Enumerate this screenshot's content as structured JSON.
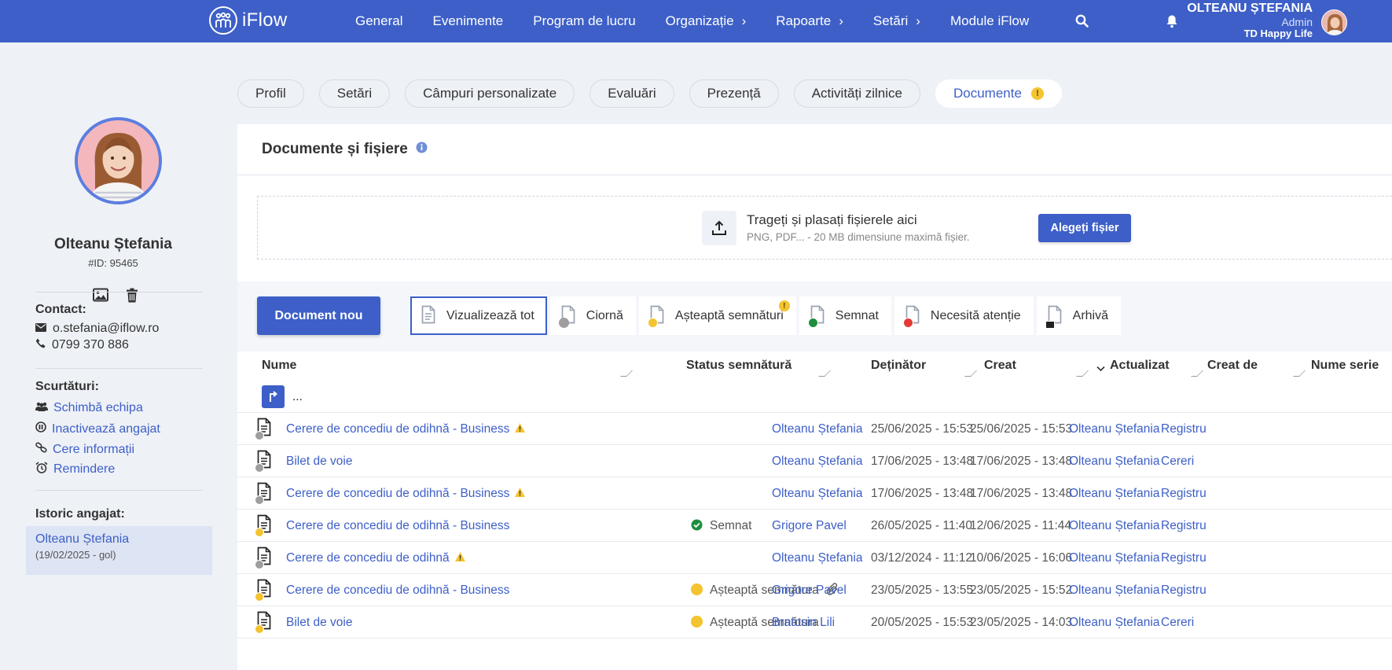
{
  "app": {
    "logo_text": "iFlow"
  },
  "nav": {
    "items": [
      {
        "label": "General",
        "chevron": false
      },
      {
        "label": "Evenimente",
        "chevron": false
      },
      {
        "label": "Program de lucru",
        "chevron": false
      },
      {
        "label": "Organizație",
        "chevron": true
      },
      {
        "label": "Rapoarte",
        "chevron": true
      },
      {
        "label": "Setări",
        "chevron": true
      },
      {
        "label": "Module iFlow",
        "chevron": false
      }
    ],
    "chevron_glyph": "›"
  },
  "user": {
    "name": "OLTEANU ȘTEFANIA",
    "role": "Admin",
    "company": "TD Happy Life"
  },
  "profile": {
    "name": "Olteanu Ștefania",
    "id": "#ID: 95465",
    "contact_label": "Contact:",
    "email": "o.stefania@iflow.ro",
    "phone": "0799 370 886",
    "shortcuts_label": "Scurtături:",
    "shortcuts": [
      "Schimbă echipa",
      "Inactivează angajat",
      "Cere informații",
      "Remindere"
    ],
    "history_label": "Istoric angajat:",
    "history_name": "Olteanu Ștefania",
    "history_period": "(19/02/2025 - gol)"
  },
  "tabs": [
    "Profil",
    "Setări",
    "Câmpuri personalizate",
    "Evaluări",
    "Prezență",
    "Activități zilnice",
    "Documente"
  ],
  "tab_warn_glyph": "!",
  "documents": {
    "title": "Documente și fișiere",
    "dropzone_title": "Trageți și plasați fișierele aici",
    "dropzone_sub": "PNG, PDF... - 20 MB dimensiune maximă fișier.",
    "choose_button": "Alegeți fișier",
    "new_button": "Document nou",
    "filters": [
      "Vizualizează tot",
      "Ciornă",
      "Așteaptă semnături",
      "Semnat",
      "Necesită atenție",
      "Arhivă"
    ],
    "columns": [
      "Nume",
      "Status semnătură",
      "Deținător",
      "Creat",
      "Actualizat",
      "Creat de",
      "Nume serie"
    ],
    "parent_dir": "...",
    "rows": [
      {
        "name": "Cerere de concediu de odihnă - Business",
        "warn": true,
        "state": "draft",
        "status": "",
        "attach": false,
        "owner": "Olteanu Ștefania",
        "created": "25/06/2025 - 15:53",
        "updated": "25/06/2025 - 15:53",
        "created_by": "Olteanu Ștefania",
        "series": "Registru"
      },
      {
        "name": "Bilet de voie",
        "warn": false,
        "state": "draft",
        "status": "",
        "attach": false,
        "owner": "Olteanu Ștefania",
        "created": "17/06/2025 - 13:48",
        "updated": "17/06/2025 - 13:48",
        "created_by": "Olteanu Ștefania",
        "series": "Cereri"
      },
      {
        "name": "Cerere de concediu de odihnă - Business",
        "warn": true,
        "state": "draft",
        "status": "",
        "attach": false,
        "owner": "Olteanu Ștefania",
        "created": "17/06/2025 - 13:48",
        "updated": "17/06/2025 - 13:48",
        "created_by": "Olteanu Ștefania",
        "series": "Registru"
      },
      {
        "name": "Cerere de concediu de odihnă - Business",
        "warn": false,
        "state": "pending",
        "status": "Semnat",
        "status_color": "#1e8e3e",
        "attach": false,
        "owner": "Grigore Pavel",
        "created": "26/05/2025 - 11:40",
        "updated": "12/06/2025 - 11:44",
        "created_by": "Olteanu Ștefania",
        "series": "Registru"
      },
      {
        "name": "Cerere de concediu de odihnă",
        "warn": true,
        "state": "draft",
        "status": "",
        "attach": false,
        "owner": "Olteanu Ștefania",
        "created": "03/12/2024 - 11:12",
        "updated": "10/06/2025 - 16:06",
        "created_by": "Olteanu Ștefania",
        "series": "Registru"
      },
      {
        "name": "Cerere de concediu de odihnă - Business",
        "warn": false,
        "state": "pending",
        "status": "Așteaptă semnătura",
        "status_color": "#f4c430",
        "attach": true,
        "owner": "Grigore Pavel",
        "created": "23/05/2025 - 13:55",
        "updated": "23/05/2025 - 15:52",
        "created_by": "Olteanu Ștefania",
        "series": "Registru"
      },
      {
        "name": "Bilet de voie",
        "warn": false,
        "state": "pending",
        "status": "Așteaptă semnătura",
        "status_color": "#f4c430",
        "attach": false,
        "owner": "Bratosin Lili",
        "created": "20/05/2025 - 15:53",
        "updated": "23/05/2025 - 14:03",
        "created_by": "Olteanu Ștefania",
        "series": "Cereri"
      }
    ]
  },
  "colors": {
    "brand": "#3d5fc7",
    "warning": "#f4c430",
    "success": "#1e8e3e",
    "danger": "#e53935",
    "draft": "#9e9e9e"
  }
}
